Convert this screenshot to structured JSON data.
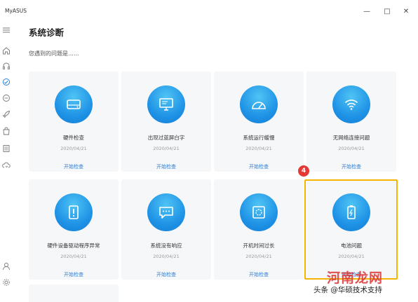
{
  "app": {
    "title": "MyASUS"
  },
  "window_controls": {
    "minimize": "—",
    "maximize": "□",
    "close": "✕"
  },
  "page": {
    "title": "系统诊断",
    "subtitle": "您遇到的问题是……"
  },
  "sidebar": {
    "items": [
      {
        "icon": "menu-icon"
      },
      {
        "icon": "home-icon"
      },
      {
        "icon": "headphones-icon"
      },
      {
        "icon": "diagnosis-icon"
      },
      {
        "icon": "link-icon"
      },
      {
        "icon": "rocket-icon"
      },
      {
        "icon": "shopping-bag-icon"
      },
      {
        "icon": "document-icon"
      },
      {
        "icon": "cloud-sync-icon"
      },
      {
        "icon": "user-icon"
      },
      {
        "icon": "gear-icon"
      }
    ]
  },
  "cards": [
    {
      "title": "硬件检查",
      "date": "2020/04/21",
      "action": "开始检查",
      "icon": "hard-drive-icon"
    },
    {
      "title": "出现过蓝屏白字",
      "date": "2020/04/21",
      "action": "开始检查",
      "icon": "monitor-icon"
    },
    {
      "title": "系统运行缓慢",
      "date": "2020/04/21",
      "action": "开始检查",
      "icon": "speedometer-icon"
    },
    {
      "title": "无网络连接问题",
      "date": "2020/04/21",
      "action": "开始检查",
      "icon": "wifi-icon"
    },
    {
      "title": "硬件设备驱动程序异常",
      "date": "2020/04/21",
      "action": "开始检查",
      "icon": "device-alert-icon"
    },
    {
      "title": "系统没有响应",
      "date": "2020/04/21",
      "action": "开始检查",
      "icon": "chat-bubble-icon"
    },
    {
      "title": "开机时间过长",
      "date": "2020/04/21",
      "action": "开始检查",
      "icon": "boot-loading-icon"
    },
    {
      "title": "电池问题",
      "date": "2020/04/21",
      "action": "开始检查",
      "icon": "battery-icon"
    }
  ],
  "annotation": {
    "step": "4",
    "color": "#f5b400"
  },
  "watermark": {
    "big": "河南龙网",
    "small": "头条 @华硕技术支持"
  },
  "colors": {
    "accent": "#2a7fd8",
    "icon_bg": "#1f93e6",
    "card_bg": "#f6f7f9",
    "badge": "#e53935"
  }
}
